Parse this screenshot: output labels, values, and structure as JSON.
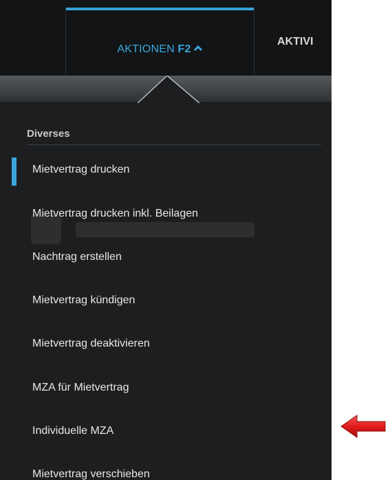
{
  "nav": {
    "active_tab": {
      "label": "AKTIONEN",
      "shortcut": "F2",
      "icon": "chevron-up-icon"
    },
    "next_tab": {
      "label": "AKTIVI"
    }
  },
  "menu": {
    "section": "Diverses",
    "items": [
      {
        "label": "Mietvertrag drucken",
        "selected": true
      },
      {
        "label": "Mietvertrag drucken inkl. Beilagen"
      },
      {
        "label": "Nachtrag erstellen"
      },
      {
        "label": "Mietvertrag kündigen"
      },
      {
        "label": "Mietvertrag deaktivieren"
      },
      {
        "label": "MZA für Mietvertrag"
      },
      {
        "label": "Individuelle MZA"
      },
      {
        "label": "Mietvertrag verschieben"
      }
    ]
  },
  "annotation": {
    "icon": "red-arrow-left-icon",
    "color": "#e01b1b",
    "points_to": "Individuelle MZA"
  },
  "colors": {
    "accent": "#35a3da",
    "panel": "#1c1e20",
    "topbar": "#121416"
  }
}
